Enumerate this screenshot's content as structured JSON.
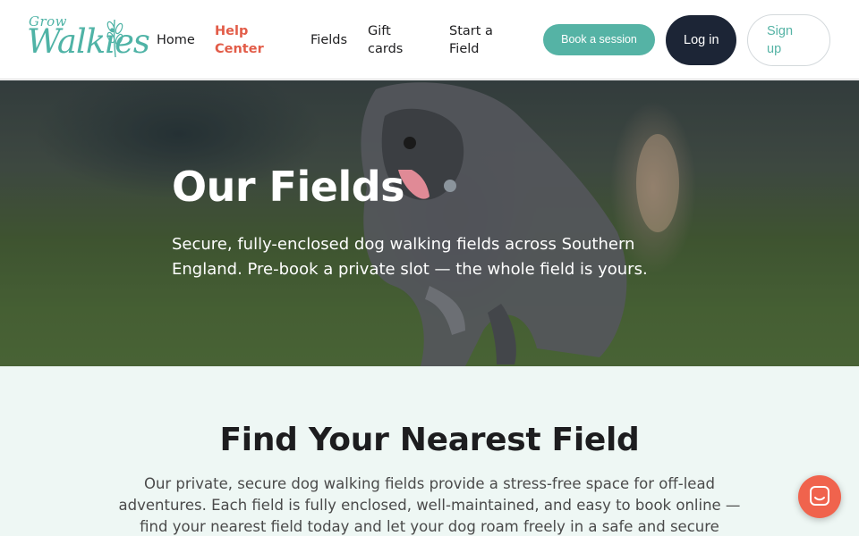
{
  "brand": {
    "logo_top": "Grow",
    "logo_main": "Walkies"
  },
  "nav": {
    "items": [
      {
        "label": "Home"
      },
      {
        "label": "Help Center"
      },
      {
        "label": "Fields"
      },
      {
        "label": "Gift cards"
      },
      {
        "label": "Start a Field"
      }
    ],
    "book_label": "Book a session",
    "login_label": "Log in",
    "signup_label": "Sign up"
  },
  "hero": {
    "title": "Our Fields",
    "subtitle": "Secure, fully-enclosed dog walking fields across Southern England. Pre-book a private slot — the whole field is yours."
  },
  "find": {
    "title": "Find Your Nearest Field",
    "description": "Our private, secure dog walking fields provide a stress-free space for off-lead adventures. Each field is fully enclosed, well-maintained, and easy to book online — find your nearest field today and let your dog roam freely in a safe and secure environment."
  },
  "chat": {
    "icon": "chat-icon"
  },
  "colors": {
    "teal": "#55b3a5",
    "navy": "#1c2536",
    "coral": "#e25c48",
    "chat": "#f0634d",
    "section_bg": "#eef7f4"
  }
}
